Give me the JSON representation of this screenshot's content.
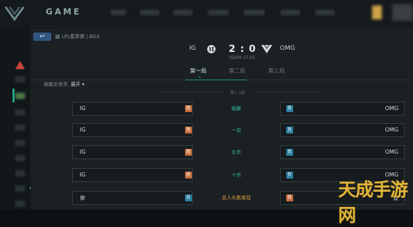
{
  "brand": "GAME",
  "colors": {
    "accent": "#1a9c86",
    "lose_badge": "#c46c3a",
    "win_badge": "#2c7fa0",
    "watermark": "#f2c23d"
  },
  "header": {
    "back_label": "↩",
    "league": "LPL春季赛 | BO3"
  },
  "match": {
    "team_left": "IG",
    "team_right": "OMG",
    "score": "2 : 0",
    "datetime": "02/04 17:10"
  },
  "tabs": [
    {
      "label": "第一局"
    },
    {
      "label": "第二局"
    },
    {
      "label": "第三局"
    }
  ],
  "filter": {
    "label": "输赢走势类",
    "value": "展开 ▾"
  },
  "section": {
    "subtitle": "第1-3局"
  },
  "rows": [
    {
      "left": "IG",
      "left_badge": "胜",
      "category": "输赢",
      "right": "OMG",
      "right_badge": "负"
    },
    {
      "left": "IG",
      "left_badge": "胜",
      "category": "一血",
      "right": "OMG",
      "right_badge": "负"
    },
    {
      "left": "IG",
      "left_badge": "胜",
      "category": "五杀",
      "right": "OMG",
      "right_badge": "负"
    },
    {
      "left": "IG",
      "left_badge": "胜",
      "category": "十杀",
      "right": "OMG",
      "right_badge": "负"
    },
    {
      "left": "单",
      "left_badge": "负",
      "category": "总人头数单双",
      "right": "双",
      "right_badge": "胜"
    }
  ],
  "watermark": "天成手游网"
}
